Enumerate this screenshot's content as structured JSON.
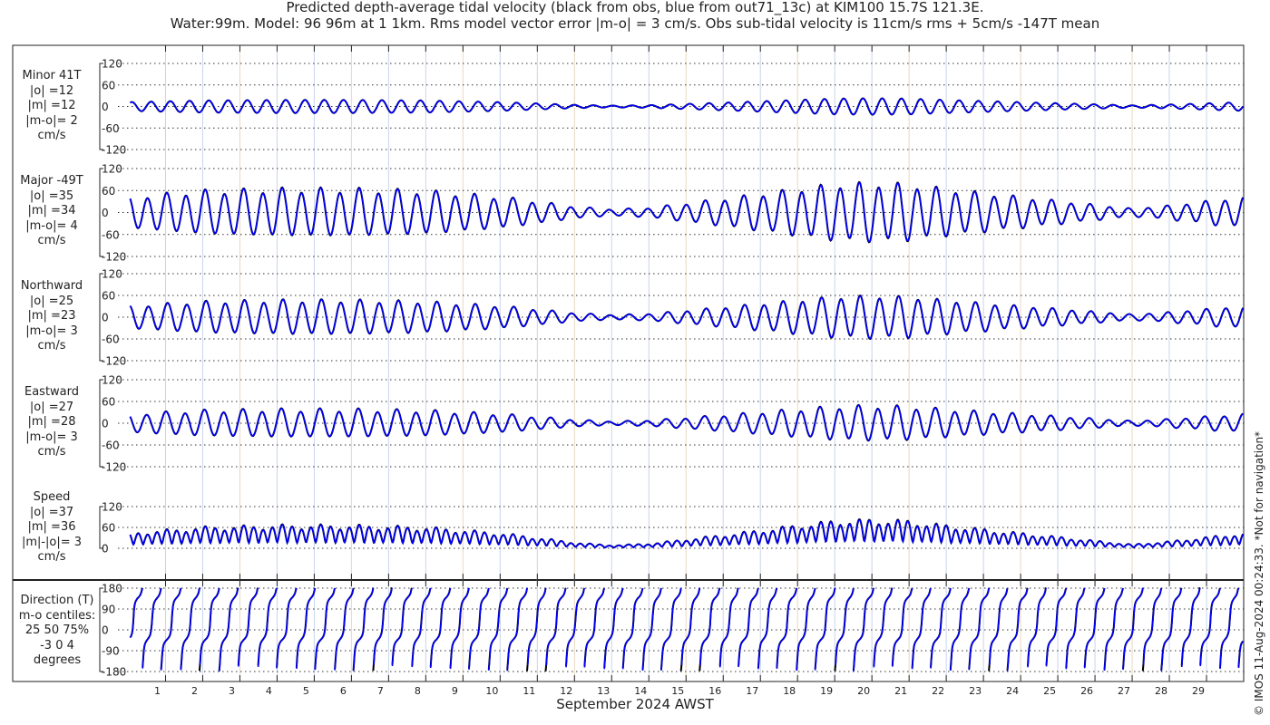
{
  "title_line1": "Predicted depth-average tidal velocity (black from obs, blue from out71_13c) at KIM100 15.7S 121.3E.",
  "title_line2": "Water:99m. Model: 96 96m at 1 1km. Rms model vector error |m-o| = 3 cm/s. Obs sub-tidal velocity is 11cm/s rms + 5cm/s -147T mean",
  "copyright": "© IMOS 11-Aug-2024 00:24:33. *Not for navigation*",
  "colors": {
    "obs": "#000000",
    "model": "#0000ff",
    "grid": "#b8c8e8"
  },
  "chart_data": {
    "type": "line",
    "xlabel": "September 2024 AWST",
    "x_ticks": [
      "1",
      "2",
      "3",
      "4",
      "5",
      "6",
      "7",
      "8",
      "9",
      "10",
      "11",
      "12",
      "13",
      "14",
      "15",
      "16",
      "17",
      "18",
      "19",
      "20",
      "21",
      "22",
      "23",
      "24",
      "25",
      "26",
      "27",
      "28",
      "29"
    ],
    "xlim_days": [
      0,
      30
    ],
    "envelope_days": [
      0,
      2,
      4,
      6,
      8,
      10,
      11,
      12,
      13,
      14,
      16,
      18,
      19,
      20,
      21,
      22,
      24,
      26,
      27,
      28,
      30
    ],
    "major_envelope": [
      40,
      55,
      60,
      60,
      55,
      40,
      28,
      15,
      8,
      12,
      35,
      60,
      72,
      75,
      72,
      60,
      40,
      20,
      10,
      18,
      40
    ],
    "panels": [
      {
        "id": "minor",
        "lines": [
          "Minor 41T",
          "|o| =12",
          "|m| =12",
          "|m-o|= 2",
          "cm/s"
        ],
        "yticks": [
          "120",
          "60",
          "0",
          "-60",
          "-120"
        ],
        "ylim": [
          -120,
          120
        ],
        "scale": 0.3
      },
      {
        "id": "major",
        "lines": [
          "Major -49T",
          "|o| =35",
          "|m| =34",
          "|m-o|= 4",
          "cm/s"
        ],
        "yticks": [
          "120",
          "60",
          "0",
          "-60",
          "-120"
        ],
        "ylim": [
          -120,
          120
        ],
        "scale": 1.0
      },
      {
        "id": "north",
        "lines": [
          "Northward",
          "|o| =25",
          "|m| =23",
          "|m-o|= 3",
          "cm/s"
        ],
        "yticks": [
          "120",
          "60",
          "0",
          "-60",
          "-120"
        ],
        "ylim": [
          -120,
          120
        ],
        "scale": 0.72
      },
      {
        "id": "east",
        "lines": [
          "Eastward",
          "|o| =27",
          "|m| =28",
          "|m-o|= 3",
          "cm/s"
        ],
        "yticks": [
          "120",
          "60",
          "0",
          "-60",
          "-120"
        ],
        "ylim": [
          -120,
          120
        ],
        "scale": 0.8
      },
      {
        "id": "speed",
        "lines": [
          "Speed",
          "|o| =37",
          "|m| =36",
          "|m|-|o|= 3",
          "cm/s"
        ],
        "yticks": [
          "120",
          "60",
          "0"
        ],
        "ylim": [
          0,
          120
        ],
        "scale": 1.0
      },
      {
        "id": "direction",
        "lines": [
          "Direction (T)",
          "m-o centiles:",
          "25  50  75%",
          "-3  0  4",
          "degrees"
        ],
        "yticks": [
          "180",
          "90",
          "0",
          "-90",
          "-180"
        ],
        "ylim": [
          -180,
          180
        ],
        "scale": 1.0
      }
    ]
  }
}
